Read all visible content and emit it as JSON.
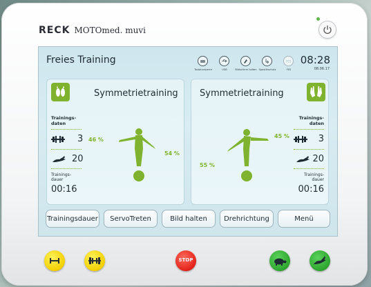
{
  "device": {
    "brand": "RECK",
    "model": "MOTOmed. muvi"
  },
  "screen": {
    "title": "Freies Training",
    "status_icons": [
      {
        "icon": "keyboard-lock-icon",
        "label": "Tastatursperre"
      },
      {
        "icon": "usb-icon",
        "label": "USB"
      },
      {
        "icon": "freeze-image-icon",
        "label": "Bildschirm halten"
      },
      {
        "icon": "spasm-protection-icon",
        "label": "Spastikschutz"
      },
      {
        "icon": "fes-icon",
        "label": "FES"
      }
    ],
    "time": "08:28",
    "date": "08.06.17"
  },
  "left_panel": {
    "title": "Symmetrietraining",
    "badge_icon": "feet-icon",
    "data_label": "Trainings-\ndaten",
    "resistance_value": "3",
    "speed_value": "20",
    "duration_label": "Trainings-\ndauer",
    "duration_value": "00:16",
    "left_percent": "46 %",
    "right_percent": "54 %"
  },
  "right_panel": {
    "title": "Symmetrietraining",
    "badge_icon": "hands-icon",
    "data_label": "Trainings-\ndaten",
    "resistance_value": "3",
    "speed_value": "20",
    "duration_label": "Trainings-\ndauer",
    "duration_value": "00:16",
    "left_percent": "55 %",
    "right_percent": "45 %"
  },
  "buttons": {
    "duration": "Trainingsdauer",
    "servo": "ServoTreten",
    "hold": "Bild halten",
    "direction": "Drehrichtung",
    "menu": "Menü"
  },
  "hardware": {
    "stop_label": "STOP"
  },
  "colors": {
    "accent_green": "#7fb32f",
    "screen_bg": "#d3e9f0",
    "stop_red": "#e3231b",
    "yellow": "#f2cf00",
    "hw_green": "#2ea52e"
  }
}
